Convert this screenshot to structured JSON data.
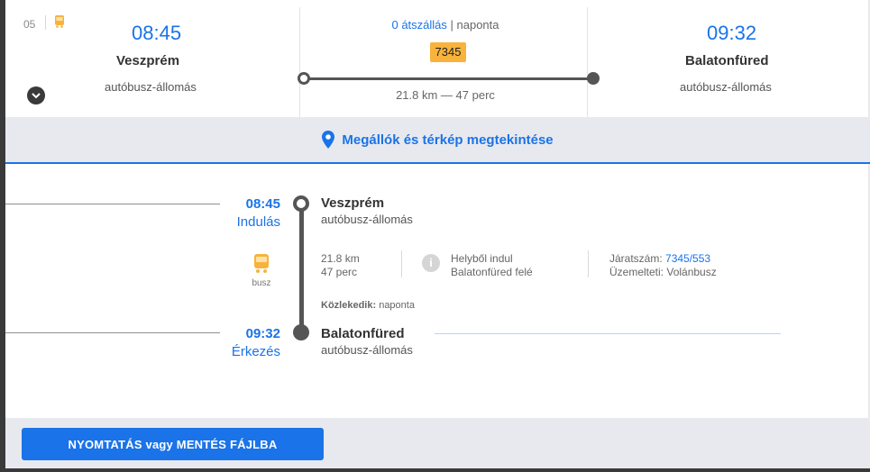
{
  "summary": {
    "line_number": "05",
    "departure": {
      "time": "08:45",
      "place": "Veszprém",
      "station": "autóbusz-állomás"
    },
    "arrival": {
      "time": "09:32",
      "place": "Balatonfüred",
      "station": "autóbusz-állomás"
    },
    "transfers_link": "0 átszállás",
    "transfers_sep": " | ",
    "frequency": "naponta",
    "route_badge": "7345",
    "distance_time": "21.8 km — 47 perc"
  },
  "map_bar": {
    "label": "Megállók és térkép megtekintése"
  },
  "timeline": {
    "start": {
      "time": "08:45",
      "label": "Indulás",
      "place": "Veszprém",
      "station": "autóbusz-állomás"
    },
    "end": {
      "time": "09:32",
      "label": "Érkezés",
      "place": "Balatonfüred",
      "station": "autóbusz-állomás"
    },
    "mode_label": "busz",
    "distance": "21.8 km",
    "duration": "47 perc",
    "info_line1": "Helyből indul",
    "info_line2": "Balatonfüred felé",
    "route_number_label": "Járatszám: ",
    "route_number": "7345/553",
    "operator": "Üzemelteti: Volánbusz",
    "operates_label": "Közlekedik:",
    "operates_value": " naponta"
  },
  "footer": {
    "print_button": "NYOMTATÁS vagy MENTÉS FÁJLBA"
  },
  "colors": {
    "accent": "#1a73e8",
    "badge": "#f7b33c",
    "line": "#555555"
  },
  "icons": [
    "bus-icon",
    "chevron-down-icon",
    "map-pin-icon",
    "info-icon"
  ]
}
